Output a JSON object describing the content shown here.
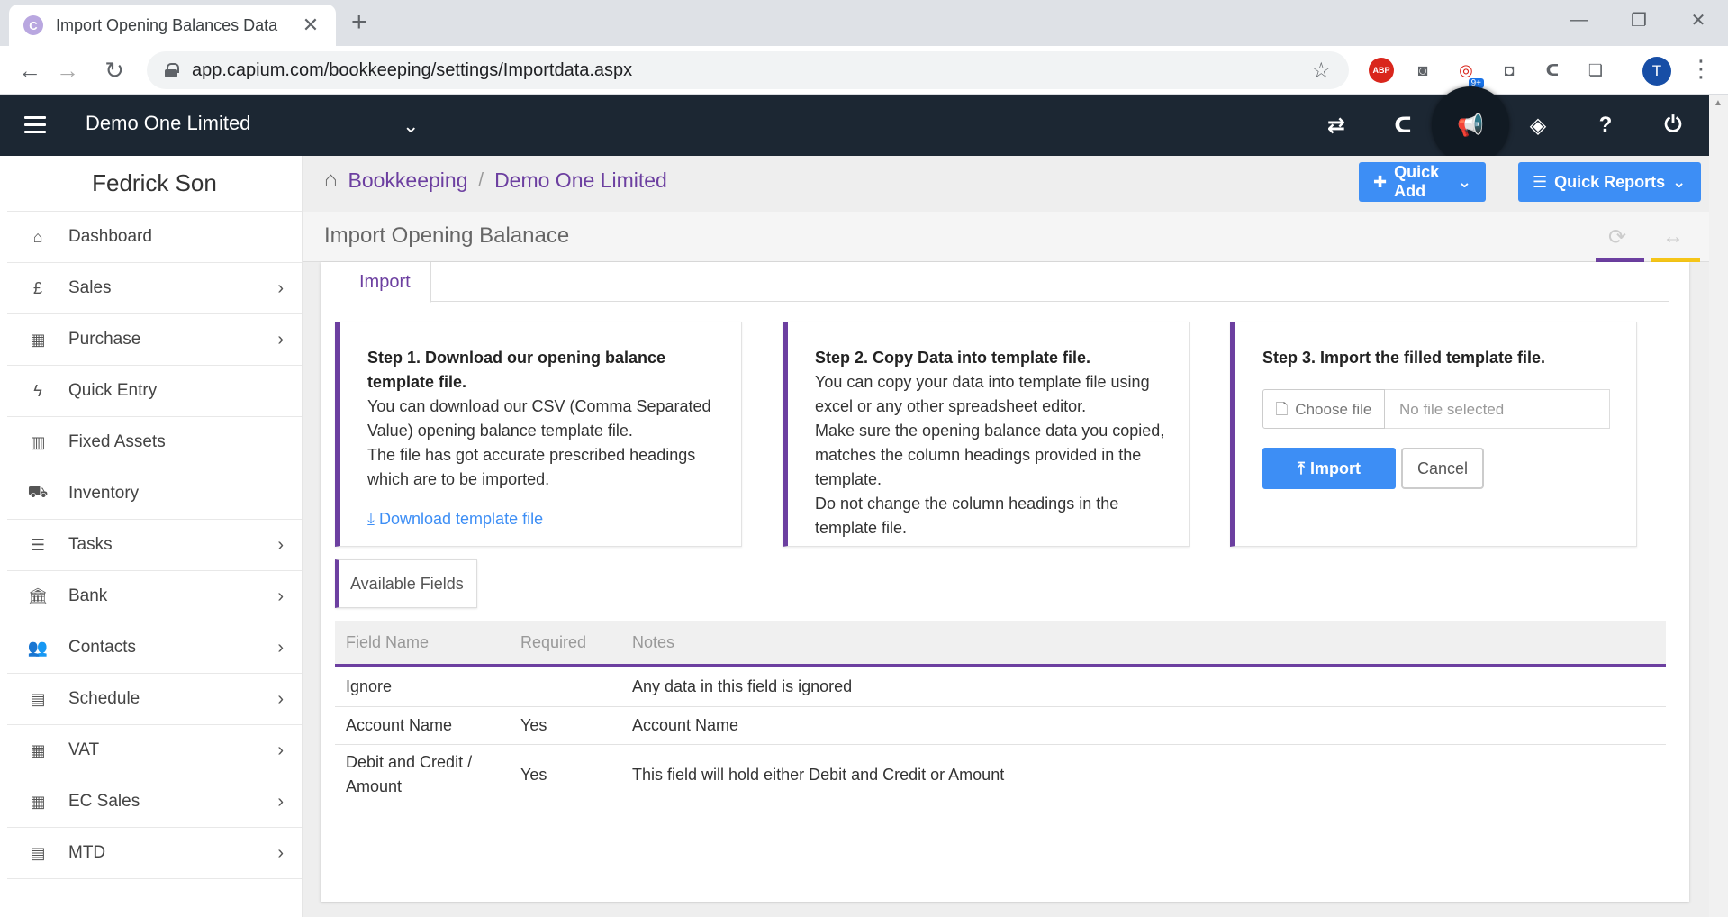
{
  "browser": {
    "tab_title": "Import Opening Balances Data",
    "tab_favicon": "C",
    "tab_close": "✕",
    "new_tab": "+",
    "url": "app.capium.com/bookkeeping/settings/Importdata.aspx",
    "ext_badge": "9+",
    "profile_initial": "T",
    "abp": "ABP"
  },
  "appbar": {
    "company": "Demo One Limited"
  },
  "sidebar": {
    "user": "Fedrick Son",
    "items": [
      {
        "label": "Dashboard",
        "icon": "home-icon",
        "chev": ""
      },
      {
        "label": "Sales",
        "icon": "pound-icon",
        "chev": "›"
      },
      {
        "label": "Purchase",
        "icon": "qrcode-icon",
        "chev": "›"
      },
      {
        "label": "Quick Entry",
        "icon": "bolt-icon",
        "chev": ""
      },
      {
        "label": "Fixed Assets",
        "icon": "building-icon",
        "chev": ""
      },
      {
        "label": "Inventory",
        "icon": "truck-icon",
        "chev": ""
      },
      {
        "label": "Tasks",
        "icon": "tasks-icon",
        "chev": "›"
      },
      {
        "label": "Bank",
        "icon": "bank-icon",
        "chev": "›"
      },
      {
        "label": "Contacts",
        "icon": "users-icon",
        "chev": "›"
      },
      {
        "label": "Schedule",
        "icon": "calendar-icon",
        "chev": "›"
      },
      {
        "label": "VAT",
        "icon": "calculator-icon",
        "chev": "›"
      },
      {
        "label": "EC Sales",
        "icon": "calculator-icon",
        "chev": "›"
      },
      {
        "label": "MTD",
        "icon": "calendar-icon",
        "chev": "›"
      }
    ]
  },
  "breadcrumb": {
    "items": [
      "Bookkeeping",
      "Demo One Limited"
    ],
    "separator": "/"
  },
  "actions": {
    "quick_add": "Quick Add",
    "quick_reports": "Quick Reports"
  },
  "page": {
    "title": "Import Opening Balanace",
    "tab": "Import"
  },
  "steps": {
    "step1": {
      "heading": "Step 1. Download our opening balance template file.",
      "lines": [
        "You can download our CSV (Comma Separated Value) opening balance template file.",
        "The file has got accurate prescribed headings which are to be imported."
      ],
      "link": "Download template file"
    },
    "step2": {
      "heading": "Step 2. Copy Data into template file.",
      "lines": [
        "You can copy your data into template file using excel or any other spreadsheet editor.",
        "Make sure the opening balance data you copied, matches the column headings provided in the template.",
        "Do not change the column headings in the template file."
      ]
    },
    "step3": {
      "heading": "Step 3. Import the filled template file.",
      "choose_file": "Choose file",
      "no_file": "No file selected",
      "import": "Import",
      "cancel": "Cancel"
    }
  },
  "fields": {
    "label": "Available Fields",
    "headers": [
      "Field Name",
      "Required",
      "Notes"
    ],
    "rows": [
      {
        "name": "Ignore",
        "required": "",
        "notes": "Any data in this field is ignored"
      },
      {
        "name": "Account Name",
        "required": "Yes",
        "notes": "Account Name"
      },
      {
        "name": "Debit and Credit / Amount",
        "required": "Yes",
        "notes": "This field will hold either Debit and Credit or Amount"
      }
    ]
  },
  "colors": {
    "appbar": "#1c2733",
    "accent_purple": "#6c3fa0",
    "primary_blue": "#3d8ef5",
    "yellow_line": "#f5c518"
  }
}
